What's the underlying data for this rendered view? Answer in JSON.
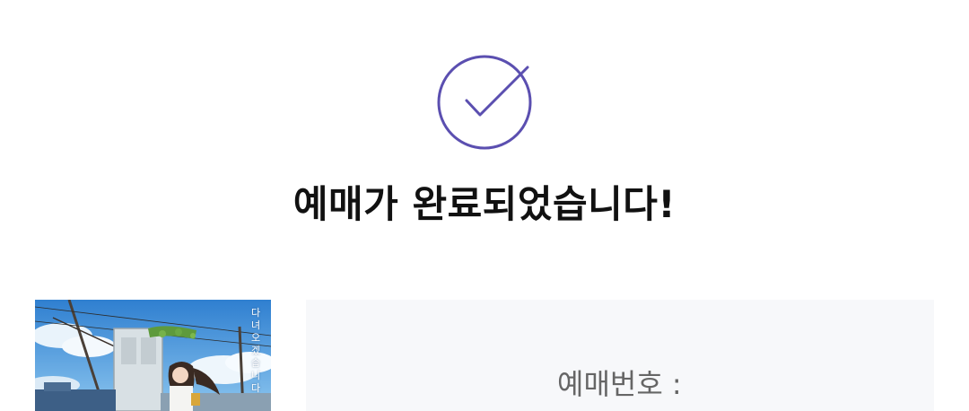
{
  "status": {
    "icon": "check-circle-icon",
    "accent_color": "#5b4fb0",
    "title": "예매가 완료되었습니다!"
  },
  "movie": {
    "poster_icon": "movie-poster-image",
    "poster_text": "다녀오겠습니다"
  },
  "reservation": {
    "number_label": "예매번호 :"
  }
}
